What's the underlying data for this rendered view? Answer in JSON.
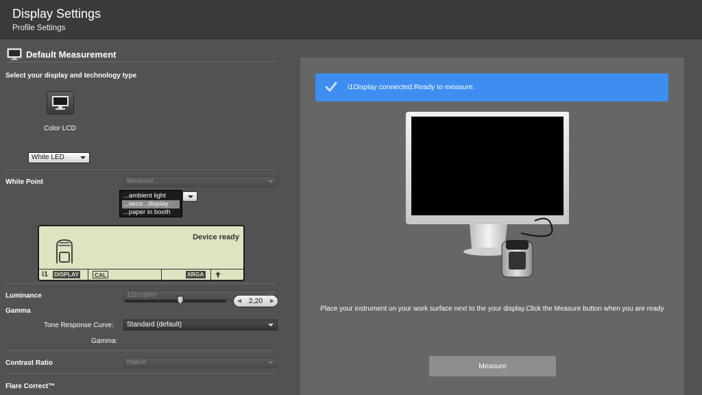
{
  "header": {
    "title": "Display Settings",
    "subtitle": "Profile Settings"
  },
  "left": {
    "section_title": "Default Measurement",
    "section_icon": "monitor-icon",
    "select_display_label": "Select your display and technology type",
    "display_type_label": "Color LCD",
    "technology_select": "White LED",
    "white_point": {
      "label": "White Point",
      "select_value": "Measure...",
      "options": [
        "...ambient light",
        "...seco...display",
        "...paper in booth"
      ],
      "selected_index": 1
    },
    "device": {
      "status": "Device ready",
      "tags": [
        "DISPLAY",
        "CAL",
        "XRGA"
      ],
      "logo": "i1",
      "icon": "bulb-icon"
    },
    "luminance": {
      "label": "Luminance",
      "value": "120 cd/m²"
    },
    "gamma": {
      "label": "Gamma",
      "trc_label": "Tone Response Curve:",
      "trc_value": "Standard (default)",
      "gamma_label": "Gamma:",
      "gamma_value": "2,20",
      "slider_fraction": 0.55
    },
    "contrast": {
      "label": "Contrast Ratio",
      "value": "Native"
    },
    "flare_label": "Flare Correct™"
  },
  "right": {
    "banner_message": "i1Display connected.Ready to measure.",
    "banner_icon": "checkmark-icon",
    "instruction": "Place your instrument on your work surface next to the your display.Click the Measure button when you are ready",
    "measure_label": "Measure"
  },
  "colors": {
    "background": "#525252",
    "header": "#3a3a3a",
    "panel": "#666666",
    "accent": "#3d8ef0",
    "lcd": "#dfe3c1"
  }
}
